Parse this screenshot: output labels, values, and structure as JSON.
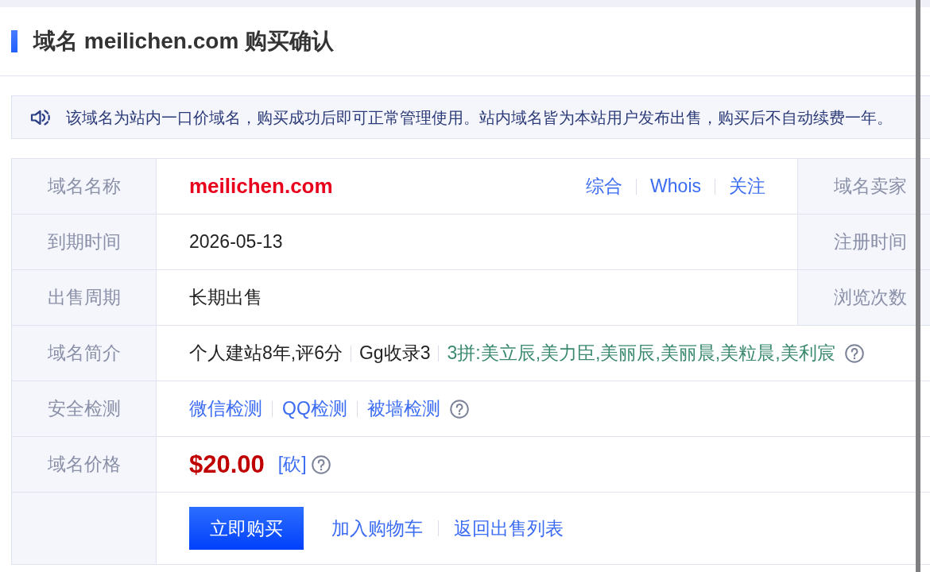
{
  "header": {
    "title": "域名 meilichen.com 购买确认"
  },
  "notice": {
    "text": "该域名为站内一口价域名，购买成功后即可正常管理使用。站内域名皆为本站用户发布出售，购买后不自动续费一年。"
  },
  "details": {
    "rows": [
      {
        "kind": "domain",
        "label": "域名名称",
        "value": "meilichen.com",
        "links": [
          "综合",
          "Whois",
          "关注"
        ],
        "side_label": "域名卖家"
      },
      {
        "kind": "text",
        "label": "到期时间",
        "value": "2026-05-13",
        "side_label": "注册时间"
      },
      {
        "kind": "text",
        "label": "出售周期",
        "value": "长期出售",
        "side_label": "浏览次数"
      },
      {
        "kind": "intro",
        "label": "域名简介",
        "segments": [
          {
            "text": "个人建站8年,评6分",
            "color": "#222222"
          },
          {
            "text": "Gg收录3",
            "color": "#222222"
          },
          {
            "text": "3拼:美立辰,美力臣,美丽辰,美丽晨,美粒晨,美利宸",
            "color": "#3b8a6e"
          }
        ]
      },
      {
        "kind": "checks",
        "label": "安全检测",
        "links": [
          "微信检测",
          "QQ检测",
          "被墙检测"
        ]
      },
      {
        "kind": "price",
        "label": "域名价格",
        "value": "$20.00",
        "bargain": "[砍]"
      },
      {
        "kind": "actions",
        "button": "立即购买",
        "links": [
          "加入购物车",
          "返回出售列表"
        ]
      }
    ]
  }
}
